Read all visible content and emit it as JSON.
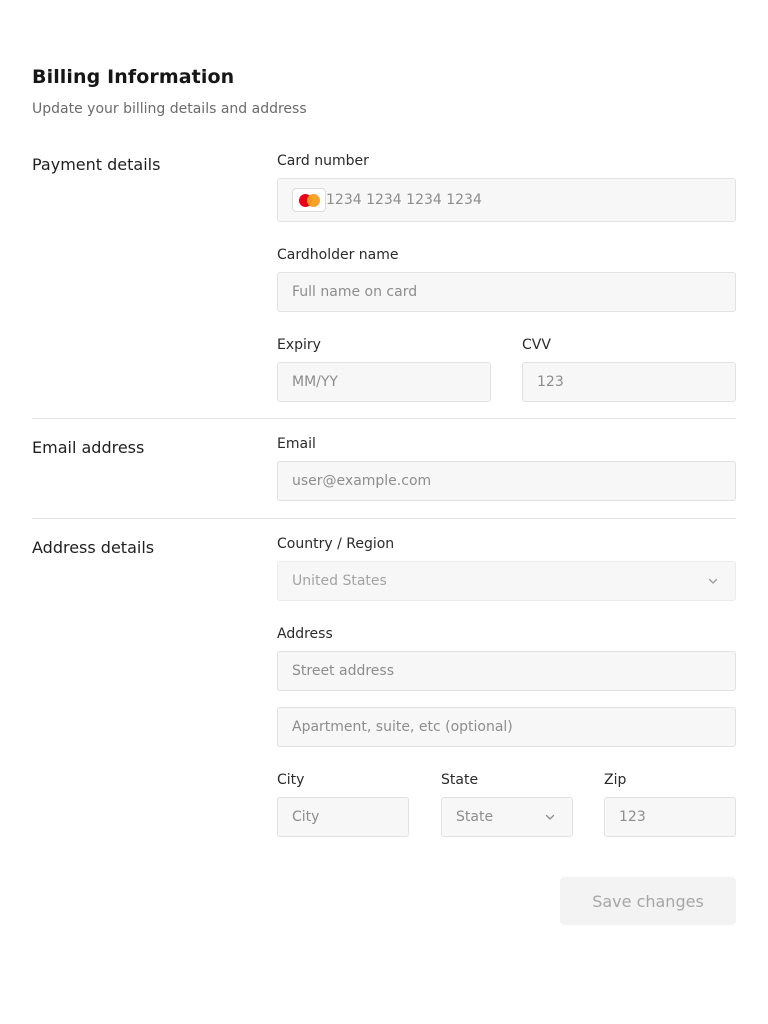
{
  "header": {
    "title": "Billing Information",
    "subtitle": "Update your billing details and address"
  },
  "payment": {
    "section_label": "Payment details",
    "card_number_label": "Card number",
    "card_number_placeholder": "1234 1234 1234 1234",
    "card_brand_icon": "mastercard-icon",
    "cardholder_label": "Cardholder name",
    "cardholder_placeholder": "Full name on card",
    "expiry_label": "Expiry",
    "expiry_placeholder": "MM/YY",
    "cvv_label": "CVV",
    "cvv_placeholder": "123"
  },
  "email": {
    "section_label": "Email address",
    "email_label": "Email",
    "email_placeholder": "user@example.com"
  },
  "address": {
    "section_label": "Address details",
    "country_label": "Country / Region",
    "country_value": "United States",
    "address_label": "Address",
    "street_placeholder": "Street address",
    "apartment_placeholder": "Apartment, suite, etc (optional)",
    "city_label": "City",
    "city_placeholder": "City",
    "state_label": "State",
    "state_value": "State",
    "zip_label": "Zip",
    "zip_placeholder": "123"
  },
  "actions": {
    "save_label": "Save changes"
  },
  "colors": {
    "mastercard_red": "#eb001b",
    "mastercard_yellow": "#f79e1b",
    "input_background": "#f7f7f7",
    "disabled_text": "#a6a6a6"
  }
}
